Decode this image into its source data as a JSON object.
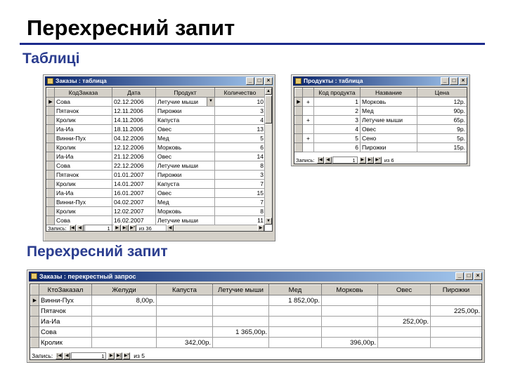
{
  "slide": {
    "title": "Перехресний запит",
    "subtitle_tables": "Таблиці",
    "subtitle_crosstab": "Перехресний запит"
  },
  "orders_window": {
    "title": "Заказы : таблица",
    "columns": [
      "КодЗаказа",
      "Дата",
      "Продукт",
      "Количество"
    ],
    "rows": [
      [
        "Сова",
        "02.12.2006",
        "Летучие мыши",
        "10"
      ],
      [
        "Пятачок",
        "12.11.2006",
        "Пирожки",
        "3"
      ],
      [
        "Кролик",
        "14.11.2006",
        "Капуста",
        "4"
      ],
      [
        "Иа-Иа",
        "18.11.2006",
        "Овес",
        "13"
      ],
      [
        "Винни-Пух",
        "04.12.2006",
        "Мед",
        "5"
      ],
      [
        "Кролик",
        "12.12.2006",
        "Морковь",
        "6"
      ],
      [
        "Иа-Иа",
        "21.12.2006",
        "Овес",
        "14"
      ],
      [
        "Сова",
        "22.12.2006",
        "Летучие мыши",
        "8"
      ],
      [
        "Пятачок",
        "01.01.2007",
        "Пирожки",
        "3"
      ],
      [
        "Кролик",
        "14.01.2007",
        "Капуста",
        "7"
      ],
      [
        "Иа-Иа",
        "16.01.2007",
        "Овес",
        "15"
      ],
      [
        "Винни-Пух",
        "04.02.2007",
        "Мед",
        "7"
      ],
      [
        "Кролик",
        "12.02.2007",
        "Морковь",
        "8"
      ],
      [
        "Сова",
        "16.02.2007",
        "Летучие мыши",
        "11"
      ]
    ],
    "record_label": "Запись:",
    "record_value": "1",
    "record_total": "из 36"
  },
  "products_window": {
    "title": "Продукты : таблица",
    "columns": [
      "Код продукта",
      "Название",
      "Цена"
    ],
    "rows": [
      [
        "+",
        "1",
        "Морковь",
        "12р."
      ],
      [
        "",
        "2",
        "Мед",
        "90р."
      ],
      [
        "+",
        "3",
        "Летучие мыши",
        "65р."
      ],
      [
        "",
        "4",
        "Овес",
        "9р."
      ],
      [
        "+",
        "5",
        "Сено",
        "5р."
      ],
      [
        "",
        "6",
        "Пирожки",
        "15р."
      ]
    ],
    "record_label": "Запись:",
    "record_value": "1",
    "record_total": "из 6"
  },
  "crosstab_window": {
    "title": "Заказы : перекрестный запрос",
    "columns": [
      "КтоЗаказал",
      "Желуди",
      "Капуста",
      "Летучие мыши",
      "Мед",
      "Морковь",
      "Овес",
      "Пирожки"
    ],
    "rows": [
      [
        "Винни-Пух",
        "8,00р.",
        "",
        "",
        "1 852,00р.",
        "",
        "",
        ""
      ],
      [
        "Пятачок",
        "",
        "",
        "",
        "",
        "",
        "",
        "225,00р."
      ],
      [
        "Иа-Иа",
        "",
        "",
        "",
        "",
        "",
        "252,00р.",
        ""
      ],
      [
        "Сова",
        "",
        "",
        "1 365,00р.",
        "",
        "",
        "",
        ""
      ],
      [
        "Кролик",
        "",
        "342,00р.",
        "",
        "",
        "396,00р.",
        "",
        ""
      ]
    ],
    "record_label": "Запись:",
    "record_value": "1",
    "record_total": "из 5"
  },
  "icons": {
    "minimize": "minimize-icon",
    "maximize": "maximize-icon",
    "close": "close-icon",
    "current_record": "current-record-arrow-icon",
    "dropdown": "dropdown-arrow-icon"
  },
  "colors": {
    "title_rule": "#1b2a8c",
    "subtitle": "#2b3d8f",
    "titlebar_start": "#0a246a",
    "titlebar_end": "#a6caf0",
    "window_face": "#d4d0c8"
  }
}
